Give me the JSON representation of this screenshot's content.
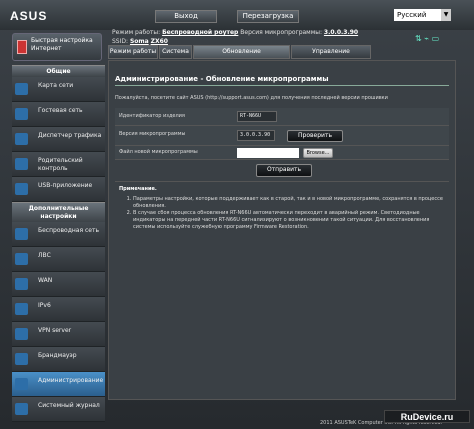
{
  "header": {
    "logo": "ASUS",
    "exit_label": "Выход",
    "reboot_label": "Перезагрузка",
    "language": "Русский"
  },
  "info": {
    "mode_label": "Режим работы:",
    "mode_value": "Беспроводной роутер",
    "fw_label": "Версия микропрограммы:",
    "fw_value": "3.0.0.3.90",
    "ssid_label": "SSID:",
    "ssid_1": "Soma",
    "ssid_2": "ZX60"
  },
  "quick_setup": "Быстрая настройка Интернет",
  "sidebar": {
    "general_header": "Общие",
    "general": [
      {
        "label": "Карта сети",
        "icon": "network-map-icon"
      },
      {
        "label": "Гостевая сеть",
        "icon": "guest-network-icon"
      },
      {
        "label": "Диспетчер трафика",
        "icon": "traffic-manager-icon"
      },
      {
        "label": "Родительский контроль",
        "icon": "parental-control-icon"
      },
      {
        "label": "USB-приложение",
        "icon": "usb-icon"
      }
    ],
    "advanced_header": "Дополнительные настройки",
    "advanced": [
      {
        "label": "Беспроводная сеть",
        "icon": "wireless-icon"
      },
      {
        "label": "ЛВС",
        "icon": "lan-icon"
      },
      {
        "label": "WAN",
        "icon": "wan-icon"
      },
      {
        "label": "IPv6",
        "icon": "ipv6-icon"
      },
      {
        "label": "VPN server",
        "icon": "vpn-icon"
      },
      {
        "label": "Брандмауэр",
        "icon": "firewall-icon"
      },
      {
        "label": "Администрирование",
        "icon": "administration-icon"
      },
      {
        "label": "Системный журнал",
        "icon": "system-log-icon"
      }
    ]
  },
  "tabs": [
    "Режим работы",
    "Система",
    "Обновление микропрограммы",
    "Управление настройками"
  ],
  "main": {
    "title": "Администрирование - Обновление микропрограммы",
    "desc": "Пожалуйста, посетите сайт ASUS (http://support.asus.com) для получения последней версии прошивки",
    "product_id_label": "Идентификатор изделия",
    "product_id_value": "RT-N66U",
    "fw_version_label": "Версия микропрограммы",
    "fw_version_value": "3.0.0.3.90",
    "check_label": "Проверить",
    "new_fw_label": "Файл новой микропрограммы",
    "browse_label": "Browse...",
    "upload_label": "Отправить"
  },
  "notes": {
    "title": "Примечание.",
    "items": [
      "Параметры настройки, которые поддерживает как в старой, так и в новой микропрограмме, сохранятся в процессе обновления.",
      "В случае сбоя процесса обновления RT-N66U автоматически переходит в аварийный режим. Светодиодные индикаторы на передней части RT-N66U сигнализируют о возникновении такой ситуации. Для восстановления системы используйте служебную программу Firmware Restoration."
    ]
  },
  "footer": "2011 ASUSTeK Computer Inc. All rights reserved.",
  "watermark": "RuDevice.ru"
}
